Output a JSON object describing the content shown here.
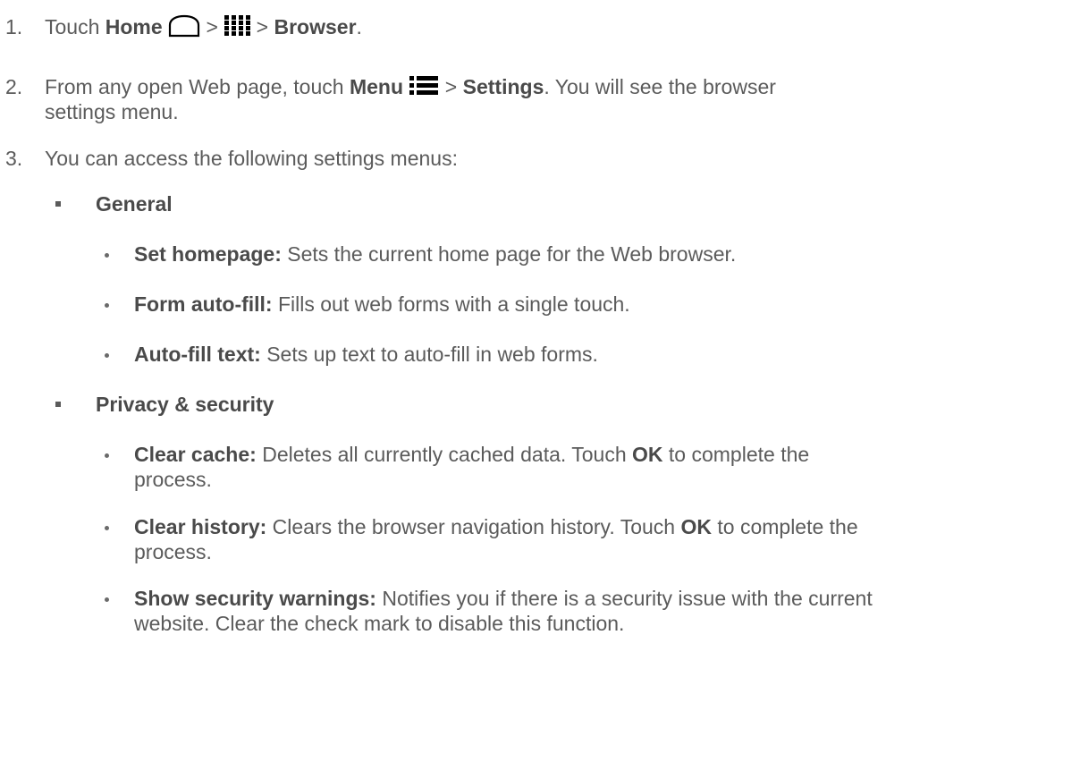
{
  "steps": [
    {
      "number": "1.",
      "prefix": "Touch",
      "home_label": "Home",
      "sep": ">",
      "browser_label": "Browser",
      "end": "."
    },
    {
      "number": "2.",
      "prefix": "From any open Web page, touch",
      "menu_label": "Menu",
      "sep": ">",
      "settings_label": "Settings",
      "suffix": ". You will see the browser",
      "continuation": "settings menu."
    },
    {
      "number": "3.",
      "text": "You can access the following settings menus:"
    }
  ],
  "sections": [
    {
      "title": "General",
      "items": [
        {
          "term": "Set homepage:",
          "desc": "Sets the current home page for the Web browser."
        },
        {
          "term": "Form auto-fill:",
          "desc": "Fills out web forms with a single touch."
        },
        {
          "term": "Auto-fill text:",
          "desc": "Sets up text to auto-fill in web forms."
        }
      ]
    },
    {
      "title": "Privacy & security",
      "items": [
        {
          "term": "Clear cache:",
          "desc": "Deletes all currently cached data. Touch",
          "bold": "OK",
          "desc2": "to complete the",
          "cont": "process."
        },
        {
          "term": "Clear history:",
          "desc": "Clears the browser navigation history. Touch",
          "bold": "OK",
          "desc2": "to complete the",
          "cont": "process."
        },
        {
          "term": "Show security warnings:",
          "desc": "Notifies you if there is a security issue with the current",
          "cont": "website. Clear the check mark to disable this function."
        }
      ]
    }
  ],
  "icons": [
    "home-icon",
    "apps-grid-icon",
    "menu-icon"
  ]
}
